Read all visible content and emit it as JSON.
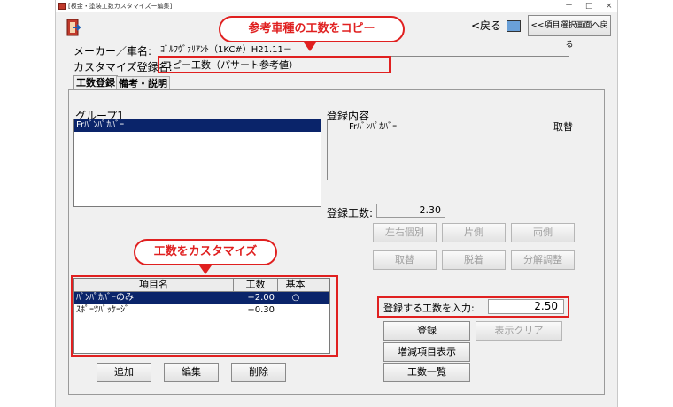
{
  "window": {
    "title": "[板金・塗装工数カスタマイズー編集]",
    "min_glyph": "－",
    "max_glyph": "□",
    "close_glyph": "×"
  },
  "toolbar": {
    "back_label": "<戻る",
    "item_select_back_label": "<<項目選択画面へ戻る"
  },
  "header": {
    "maker_label": "メーカー／車名:",
    "maker_value": "ｺﾞﾙﾌｳﾞｧﾘｱﾝﾄ（1KC#）H21.11－",
    "customize_label": "カスタマイズ登録名:",
    "customize_value": "コピー工数（パサート参考値）"
  },
  "tabs": [
    {
      "label": "工数登録"
    },
    {
      "label": "備考・説明"
    }
  ],
  "group": {
    "label": "グループ1",
    "items": [
      "Frﾊﾞﾝﾊﾟｶﾊﾞｰ"
    ]
  },
  "registered": {
    "label": "登録内容",
    "item": "Frﾊﾞﾝﾊﾟｶﾊﾞｰ",
    "action": "取替"
  },
  "registered_hours": {
    "label": "登録工数:",
    "value": "2.30"
  },
  "side_buttons": {
    "left_right_individual": "左右個別",
    "one_side": "片側",
    "both_sides": "両側",
    "replace": "取替",
    "detach": "脱着",
    "disassembly": "分解調整"
  },
  "items_table": {
    "headers": [
      "項目名",
      "工数",
      "基本"
    ],
    "rows": [
      {
        "name": "ﾊﾞﾝﾊﾟｶﾊﾞｰのみ",
        "hours": "+2.00",
        "basic": "○"
      },
      {
        "name": "ｽﾎﾟｰﾂﾊﾟｯｹｰｼﾞ",
        "hours": "+0.30",
        "basic": ""
      }
    ]
  },
  "input_hours": {
    "label": "登録する工数を入力:",
    "value": "2.50"
  },
  "action_buttons": {
    "register": "登録",
    "clear_display": "表示クリア",
    "show_increase": "増減項目表示",
    "hours_list": "工数一覧",
    "add": "追加",
    "edit": "編集",
    "delete": "削除"
  },
  "callouts": {
    "copy": "参考車種の工数をコピー",
    "customize": "工数をカスタマイズ"
  },
  "colors": {
    "selection": "#0a246a",
    "annotation_red": "#e02020"
  }
}
